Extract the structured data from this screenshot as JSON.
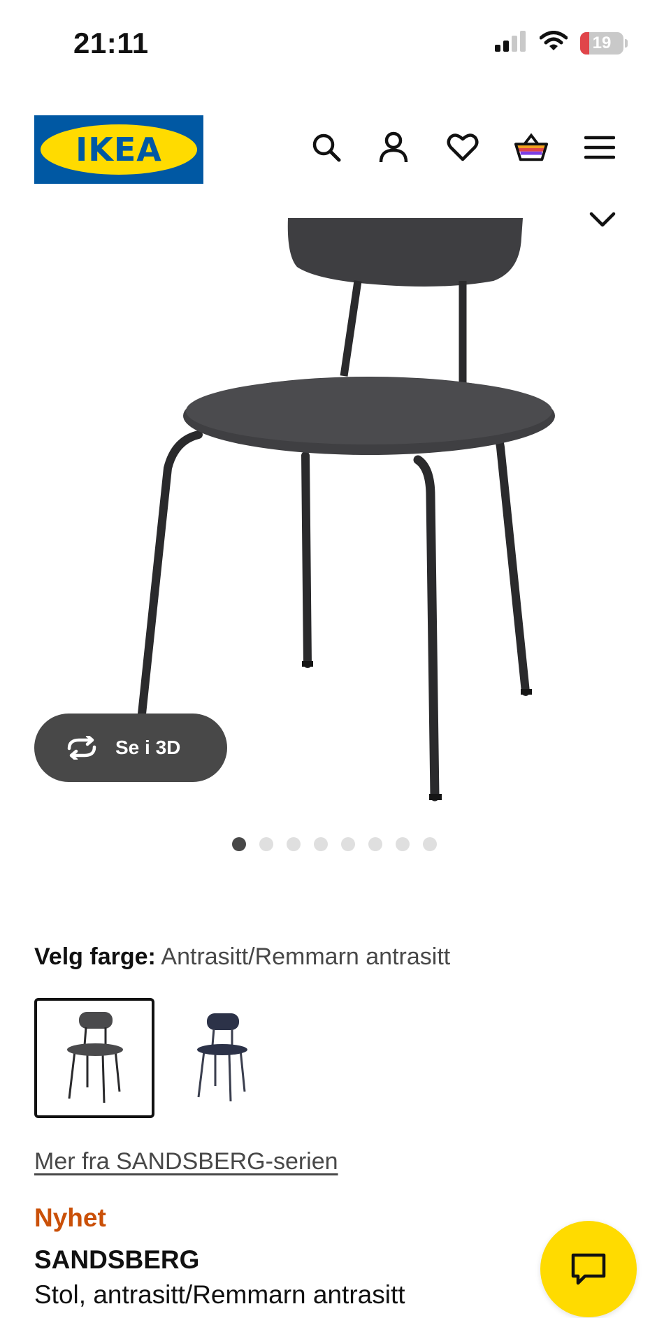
{
  "status_bar": {
    "time": "21:11",
    "battery_level": "19",
    "icons": [
      "signal-icon",
      "wifi-icon",
      "battery-icon"
    ]
  },
  "header": {
    "logo_text": "IKEA",
    "icons": [
      "search-icon",
      "account-icon",
      "heart-icon",
      "basket-icon",
      "menu-icon"
    ]
  },
  "gallery": {
    "view_3d_label": "Se i 3D",
    "image_count": 8,
    "active_index": 0
  },
  "color_selector": {
    "label": "Velg farge:",
    "selected_value": "Antrasitt/Remmarn antrasitt",
    "options": [
      {
        "name": "anthracite-chair-swatch",
        "color": "#4a4a4c",
        "selected": true
      },
      {
        "name": "blue-chair-swatch",
        "color": "#2c3248",
        "selected": false
      }
    ]
  },
  "series_link": "Mer fra SANDSBERG-serien",
  "product": {
    "badge": "Nyhet",
    "name": "SANDSBERG",
    "description": "Stol, antrasitt/Remmarn antrasitt"
  },
  "colors": {
    "brand_blue": "#0058a3",
    "brand_yellow": "#ffdb00",
    "new_badge": "#ca5008",
    "dark_button": "#484848"
  }
}
